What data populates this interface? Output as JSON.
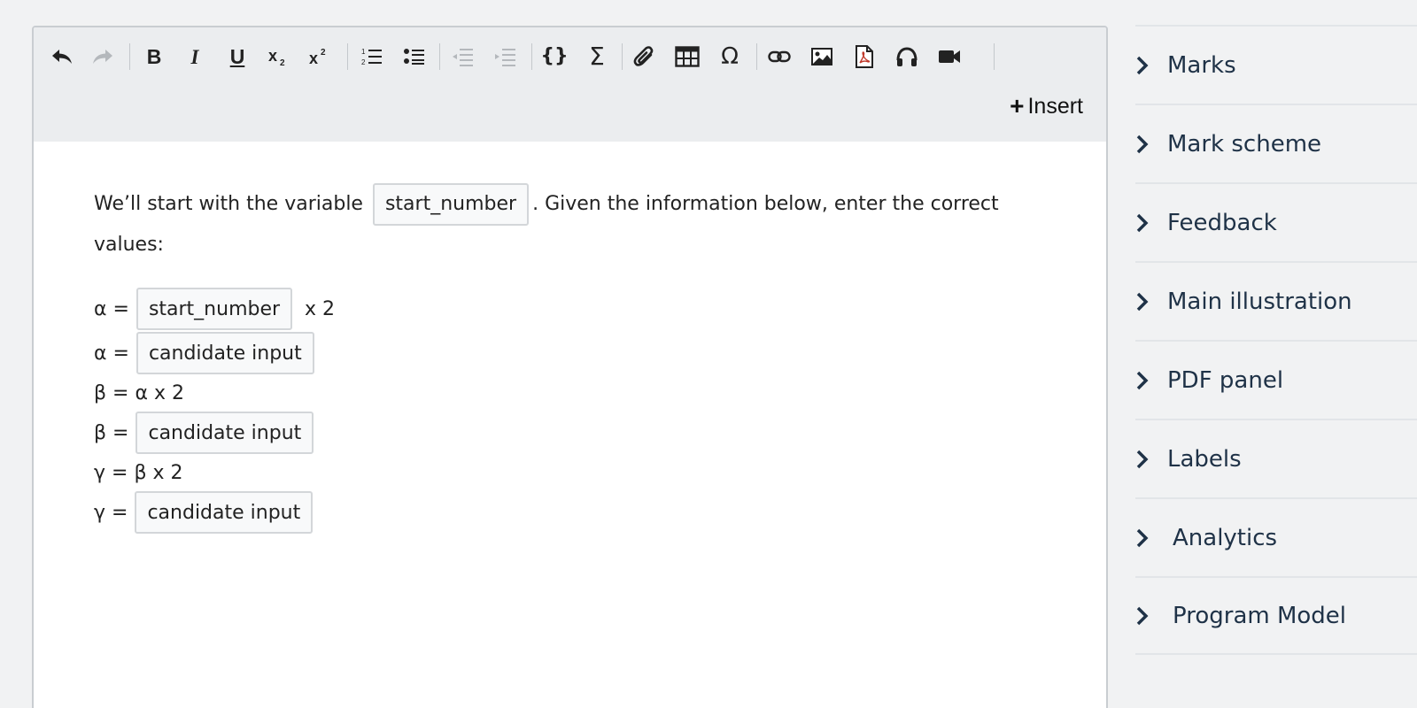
{
  "toolbar": {
    "buttons": [
      {
        "name": "undo-icon",
        "enabled": true
      },
      {
        "name": "redo-icon",
        "enabled": false
      },
      {
        "name": "bold-icon",
        "label": "B"
      },
      {
        "name": "italic-icon",
        "label": "I"
      },
      {
        "name": "underline-icon",
        "label": "U"
      },
      {
        "name": "subscript-icon"
      },
      {
        "name": "superscript-icon"
      },
      {
        "name": "numbered-list-icon"
      },
      {
        "name": "bulleted-list-icon"
      },
      {
        "name": "outdent-icon",
        "enabled": false
      },
      {
        "name": "indent-icon",
        "enabled": false
      },
      {
        "name": "code-braces-icon",
        "label": "{}"
      },
      {
        "name": "sum-icon",
        "label": "Σ"
      },
      {
        "name": "attachment-icon"
      },
      {
        "name": "table-icon"
      },
      {
        "name": "special-character-icon",
        "label": "Ω"
      },
      {
        "name": "link-icon"
      },
      {
        "name": "image-icon"
      },
      {
        "name": "pdf-icon"
      },
      {
        "name": "audio-icon"
      },
      {
        "name": "video-icon"
      }
    ],
    "insert_label": "Insert",
    "insert_icon": "plus-icon"
  },
  "content": {
    "intro_before": "We’ll start with the variable",
    "intro_variable": "start_number",
    "intro_after": ".  Given the information below, enter the correct",
    "intro_wrap": "values:",
    "lines": [
      {
        "prefix": "α =",
        "chip": "start_number",
        "suffix": "x 2"
      },
      {
        "prefix": "α =",
        "chip": "candidate input",
        "suffix": ""
      },
      {
        "text": "β = α x 2"
      },
      {
        "prefix": "β =",
        "chip": "candidate input",
        "suffix": ""
      },
      {
        "text": "γ = β x 2"
      },
      {
        "prefix": "γ =",
        "chip": "candidate input",
        "suffix": ""
      }
    ]
  },
  "sidebar": {
    "items": [
      {
        "label": "Marks"
      },
      {
        "label": "Mark scheme"
      },
      {
        "label": "Feedback"
      },
      {
        "label": "Main illustration"
      },
      {
        "label": "PDF panel"
      },
      {
        "label": "Labels"
      },
      {
        "label": "Analytics"
      },
      {
        "label": "Program Model"
      }
    ]
  },
  "colors": {
    "page_bg": "#f1f2f3",
    "toolbar_bg": "#ebedef",
    "sidebar_text": "#1f3247",
    "chip_border": "#d3d6d9"
  }
}
